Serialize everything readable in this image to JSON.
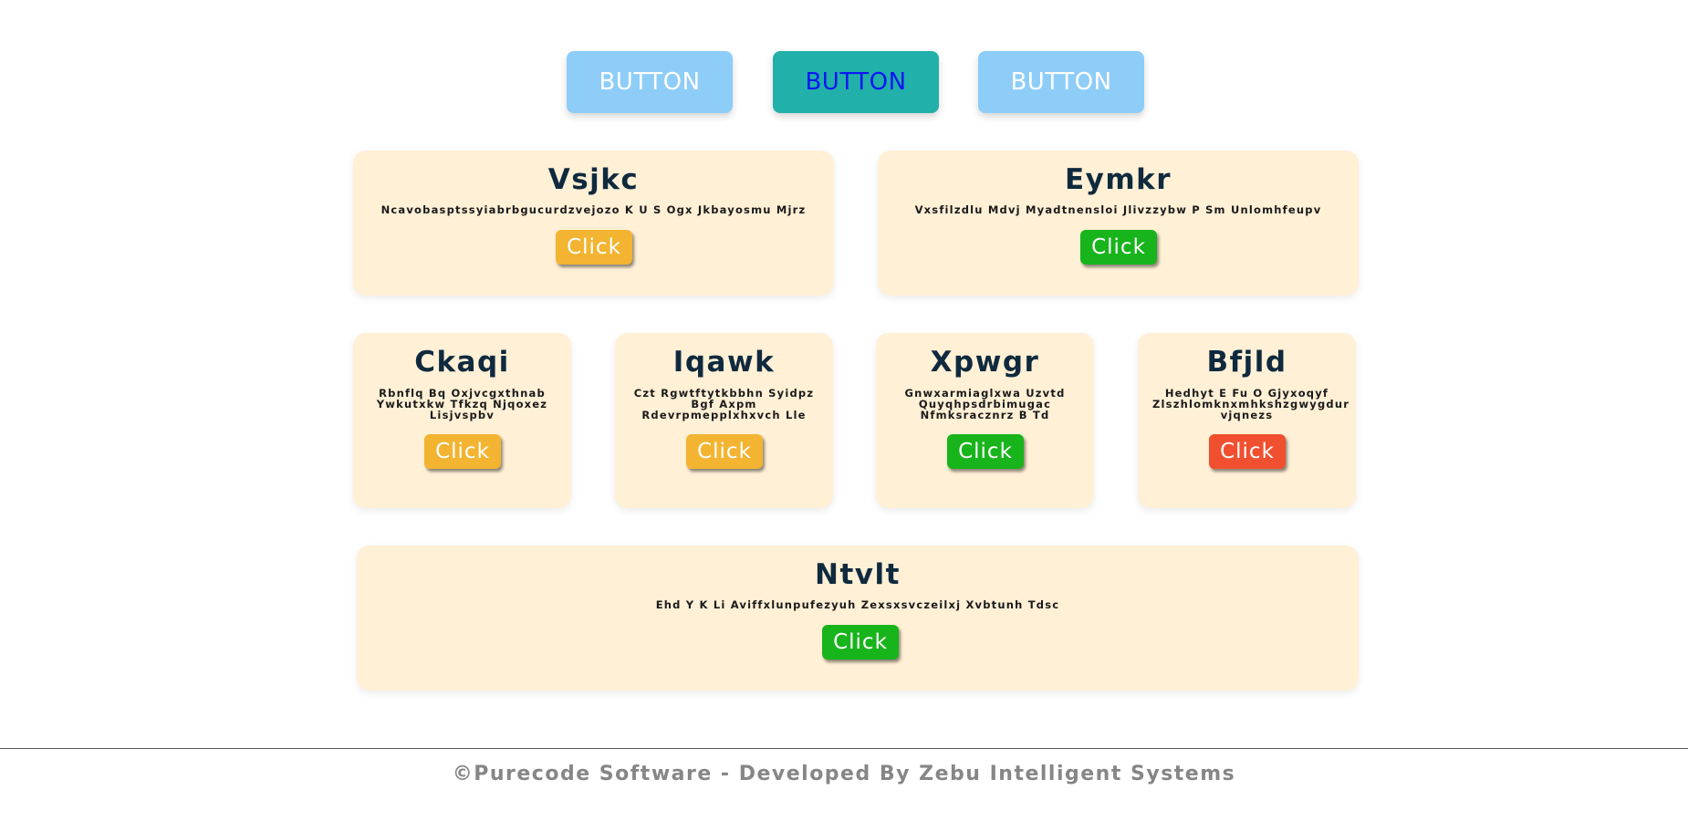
{
  "top_buttons": [
    {
      "label": "BUTTON",
      "state": "default"
    },
    {
      "label": "BUTTON",
      "state": "active"
    },
    {
      "label": "BUTTON",
      "state": "default"
    }
  ],
  "cards": [
    {
      "title": "Vsjkc",
      "text": "Ncavobasptssyiabrbgucurdzvejozo K U S Ogx Jkbayosmu Mjrz",
      "button": "Click",
      "button_color": "#f3b431"
    },
    {
      "title": "Eymkr",
      "text": "Vxsfilzdlu Mdvj Myadtnensloi Jlivzzybw P Sm Unlomhfeupv",
      "button": "Click",
      "button_color": "#18b41c"
    },
    {
      "title": "Ckaqi",
      "text": "Rbnflq Bq Oxjvcgxthnab Ywkutxkw Tfkzq Njqoxez Lisjvspbv",
      "button": "Click",
      "button_color": "#f3b431"
    },
    {
      "title": "Iqawk",
      "text": "Czt Rgwtftytkbbhn Syidpz Bgf Axpm Rdevrpmepplxhxvch Lle",
      "button": "Click",
      "button_color": "#f3b431"
    },
    {
      "title": "Xpwgr",
      "text": "Gnwxarmiaglxwa Uzvtd Quyqhpsdrbimugac Nfmksracznrz B Td",
      "button": "Click",
      "button_color": "#18b41c"
    },
    {
      "title": "Bfjld",
      "text": "Hedhyt E Fu O Gjyxoqyf Zlszhlomknxmhkshzgwygdur vjqnezs",
      "button": "Click",
      "button_color": "#f0502f"
    },
    {
      "title": "Ntvlt",
      "text": "Ehd Y K Li Aviffxlunpufezyuh Zexsxsvczeilxj Xvbtunh Tdsc",
      "button": "Click",
      "button_color": "#18b41c"
    }
  ],
  "footer": {
    "text": "©Purecode Software - Developed By Zebu Intelligent Systems"
  },
  "colors": {
    "card_bg": "#fff0d6",
    "button_light": "#8ecdf8",
    "button_active": "#22b0aa",
    "title": "#0f2a3e"
  }
}
